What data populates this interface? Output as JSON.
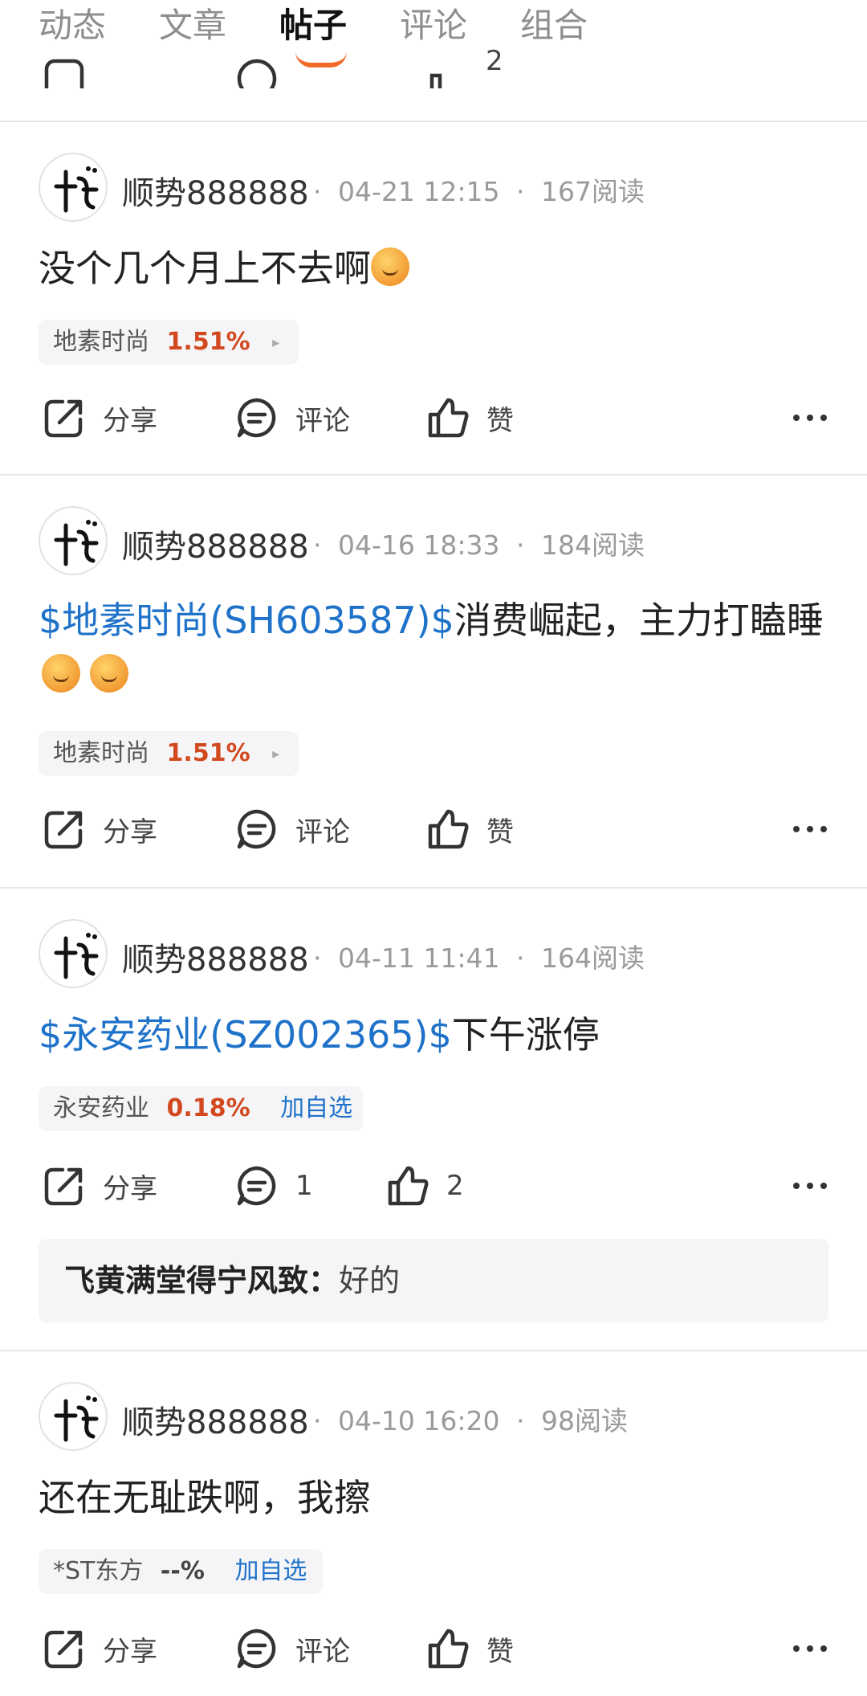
{
  "tabs": [
    {
      "label": "动态",
      "active": false
    },
    {
      "label": "文章",
      "active": false
    },
    {
      "label": "帖子",
      "active": true
    },
    {
      "label": "评论",
      "active": false
    },
    {
      "label": "组合",
      "active": false
    }
  ],
  "colors": {
    "accent": "#f26a2a",
    "link": "#1f72c9",
    "up": "#d2491f"
  },
  "posts": [
    {
      "author": "顺势888888",
      "time": "04-21 12:15",
      "reads": "167阅读",
      "content_tag": "",
      "content_text": "没个几个月上不去啊",
      "emojis": [
        "sleeping-face"
      ],
      "stock": {
        "name": "地素时尚",
        "pct": "1.51%",
        "action": "▸"
      },
      "share": "分享",
      "comment": "评论",
      "like": "赞"
    },
    {
      "author": "顺势888888",
      "time": "04-16 18:33",
      "reads": "184阅读",
      "content_tag": "$地素时尚(SH603587)$",
      "content_text": "消费崛起，主力打瞌睡",
      "emojis": [
        "sweat-face",
        "sweat-face"
      ],
      "stock": {
        "name": "地素时尚",
        "pct": "1.51%",
        "action": "▸"
      },
      "share": "分享",
      "comment": "评论",
      "like": "赞"
    },
    {
      "author": "顺势888888",
      "time": "04-11 11:41",
      "reads": "164阅读",
      "content_tag": "$永安药业(SZ002365)$",
      "content_text": "下午涨停",
      "emojis": [],
      "stock": {
        "name": "永安药业",
        "pct": "0.18%",
        "action": "加自选"
      },
      "share": "分享",
      "comment": "1",
      "like": "2",
      "reply": {
        "name": "飞黄满堂得宁风致",
        "sep": "：",
        "text": "好的"
      }
    },
    {
      "author": "顺势888888",
      "time": "04-10 16:20",
      "reads": "98阅读",
      "content_tag": "",
      "content_text": "还在无耻跌啊，我擦",
      "emojis": [],
      "stock": {
        "name": "*ST东方",
        "pct": "--%",
        "action": "加自选"
      },
      "share": "分享",
      "comment": "评论",
      "like": "赞"
    }
  ],
  "meta_dot": "·",
  "partial_last": "2"
}
